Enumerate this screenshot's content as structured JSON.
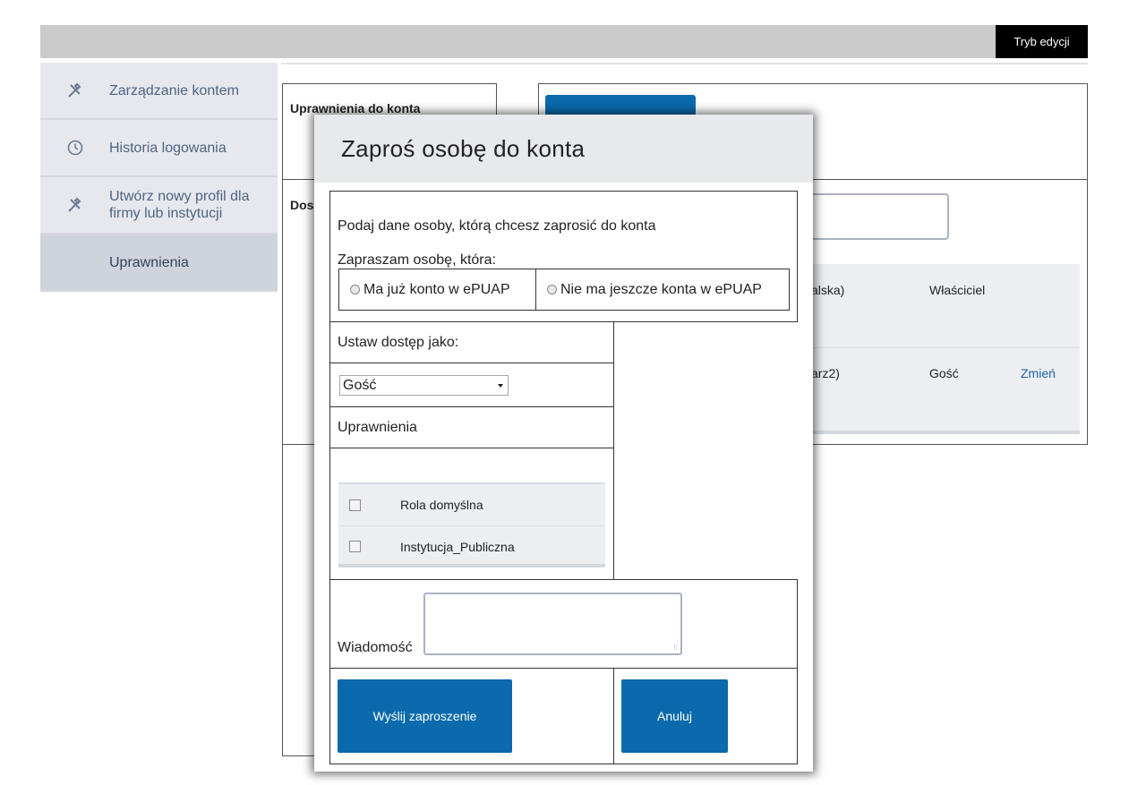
{
  "topbar": {
    "edit_mode_label": "Tryb edycji"
  },
  "sidebar": {
    "items": [
      {
        "label": "Zarządzanie kontem",
        "icon": "tools-icon"
      },
      {
        "label": "Historia logowania",
        "icon": "clock-icon"
      },
      {
        "label": "Utwórz nowy profil dla firmy lub instytucji",
        "icon": "tools-icon"
      },
      {
        "label": "Uprawnienia",
        "icon": ""
      }
    ]
  },
  "background": {
    "account_permissions_title": "Uprawnienia do konta",
    "access_title_partial": "Dos",
    "rows": [
      {
        "name_partial": "alska)",
        "role": "Właściciel",
        "action": ""
      },
      {
        "name_partial": "arz2)",
        "role": "Gość",
        "action": "Zmień"
      }
    ]
  },
  "modal": {
    "title": "Zaproś osobę do konta",
    "intro": "Podaj dane osoby, którą chcesz zaprosić do konta",
    "invite_label": "Zapraszam osobę, która:",
    "radio_has_account": "Ma już konto w ePUAP",
    "radio_no_account": "Nie ma jeszcze konta w ePUAP",
    "access_label": "Ustaw dostęp jako:",
    "access_selected": "Gość",
    "permissions_label": "Uprawnienia",
    "roles": [
      "Rola domyślna",
      "Instytucja_Publiczna"
    ],
    "message_label": "Wiadomość",
    "send_label": "Wyślij zaproszenie",
    "cancel_label": "Anuluj"
  }
}
